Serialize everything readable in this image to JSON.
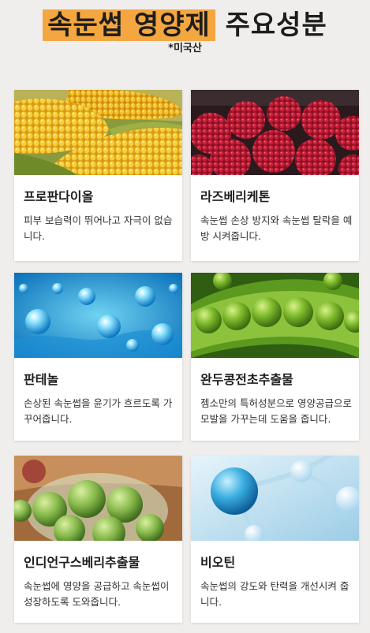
{
  "header": {
    "title_highlight": "속눈썹 영양제",
    "title_rest": "주요성분",
    "subtitle": "*미국산"
  },
  "ingredients": [
    {
      "name": "프로판다이올",
      "description": "피부 보습력이 뛰어나고 자극이 없습니다.",
      "icon": "corn-image"
    },
    {
      "name": "라즈베리케톤",
      "description": "속눈썹 손상 방지와 속눈썹 탈락을 예방 시켜줍니다.",
      "icon": "raspberry-image"
    },
    {
      "name": "판테놀",
      "description": "손상된 속눈썹을 윤기가 흐르도록 가꾸어줍니다.",
      "icon": "water-drop-image"
    },
    {
      "name": "완두콩전초추출물",
      "description": "젬소만의 특허성분으로 영양공급으로 모발을 가꾸는데 도움을 줍니다.",
      "icon": "peas-image"
    },
    {
      "name": "인디언구스베리추출물",
      "description": "속눈썹에 영양을 공급하고 속눈썹이 성장하도록 도와줍니다.",
      "icon": "gooseberry-image"
    },
    {
      "name": "비오틴",
      "description": "속눈썹의 강도와 탄력을 개선시켜 줍니다.",
      "icon": "molecule-image"
    }
  ]
}
